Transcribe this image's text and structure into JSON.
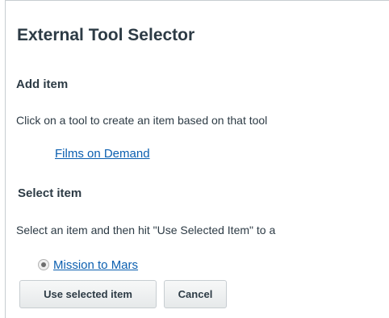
{
  "page": {
    "title": "External Tool Selector"
  },
  "add_section": {
    "heading": "Add item",
    "instructions": "Click on a tool to create an item based on that tool",
    "tools": [
      {
        "label": "Films on Demand"
      }
    ]
  },
  "select_section": {
    "heading": "Select item",
    "instructions": "Select an item and then hit \"Use Selected Item\" to a",
    "items": [
      {
        "label": "Mission to Mars",
        "selected": true
      }
    ]
  },
  "actions": {
    "use_label": "Use selected item",
    "cancel_label": "Cancel"
  },
  "colors": {
    "text": "#2d3b45",
    "link": "#0b5fb0",
    "button_border": "#c7cdd1",
    "background": "#ffffff"
  },
  "icons": {
    "radio": "radio-selected-icon"
  }
}
